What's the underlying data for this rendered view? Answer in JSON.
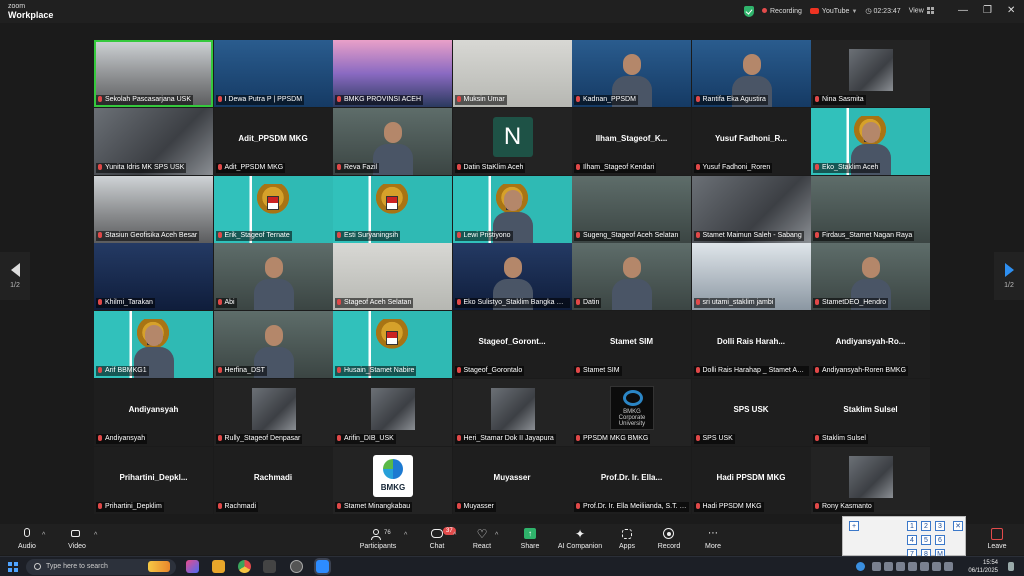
{
  "app": {
    "title_line1": "zoom",
    "title_line2": "Workplace"
  },
  "titlebar": {
    "recording": "Recording",
    "youtube": "YouTube",
    "timer": "02:23:47",
    "view": "View",
    "win_min": "—",
    "win_max": "❐",
    "win_close": "✕"
  },
  "gallery": {
    "page_left": "1/2",
    "page_right": "1/2",
    "tiles": [
      {
        "caption": "Sekolah Pascasarjana USK",
        "center": "",
        "kind": "room",
        "speaking": true
      },
      {
        "caption": "I Dewa Putra P | PPSDM",
        "center": "",
        "kind": "banner"
      },
      {
        "caption": "BMKG PROVINSI ACEH",
        "center": "",
        "kind": "mosque"
      },
      {
        "caption": "Muksin Umar",
        "center": "",
        "kind": "whiteboard"
      },
      {
        "caption": "Kadnan_PPSDM",
        "center": "",
        "kind": "banner-person"
      },
      {
        "caption": "Rantifa Eka Agustira",
        "center": "",
        "kind": "banner-person"
      },
      {
        "caption": "Nina Sasmita",
        "center": "",
        "kind": "small-photo"
      },
      {
        "caption": "Yunita Idris MK SPS USK",
        "center": "",
        "kind": "photo"
      },
      {
        "caption": "Adit_PPSDM MKG",
        "center": "Adit_PPSDM MKG",
        "kind": "blank"
      },
      {
        "caption": "Reva Fazil",
        "center": "",
        "kind": "person"
      },
      {
        "caption": "Datin StaKlim Aceh",
        "center": "",
        "kind": "letter",
        "letter": "N"
      },
      {
        "caption": "Ilham_Stageof Kendari",
        "center": "Ilham_Stageof_K...",
        "kind": "blank"
      },
      {
        "caption": "Yusuf Fadhoni_Roren",
        "center": "Yusuf Fadhoni_R...",
        "kind": "blank"
      },
      {
        "caption": "Eko_Staklim Aceh",
        "center": "",
        "kind": "teal-person"
      },
      {
        "caption": "Stasiun Geofisika Aceh Besar",
        "center": "",
        "kind": "room"
      },
      {
        "caption": "Erik_Stageof Ternate",
        "center": "",
        "kind": "teal"
      },
      {
        "caption": "Esti Suryaningsih",
        "center": "",
        "kind": "teal"
      },
      {
        "caption": "Lewi Pristiyono",
        "center": "",
        "kind": "teal-person"
      },
      {
        "caption": "Sugeng_Stageof Aceh Selatan",
        "center": "",
        "kind": "office"
      },
      {
        "caption": "Stamet Maimun Saleh - Sabang",
        "center": "",
        "kind": "photo"
      },
      {
        "caption": "Firdaus_Stamet Nagan Raya",
        "center": "",
        "kind": "office"
      },
      {
        "caption": "Khilmi_Tarakan",
        "center": "",
        "kind": "screen"
      },
      {
        "caption": "Abi",
        "center": "",
        "kind": "person"
      },
      {
        "caption": "Stageof Aceh Selatan",
        "center": "",
        "kind": "whiteboard"
      },
      {
        "caption": "Eko Sulistyo_Staklim Bangka Belit...",
        "center": "",
        "kind": "screen-person"
      },
      {
        "caption": "Datin",
        "center": "",
        "kind": "person"
      },
      {
        "caption": "sri utami_staklim jambi",
        "center": "",
        "kind": "city"
      },
      {
        "caption": "StametDEO_Hendro",
        "center": "",
        "kind": "person"
      },
      {
        "caption": "Arif BBMKG1",
        "center": "",
        "kind": "teal-person"
      },
      {
        "caption": "Herfina_DST",
        "center": "",
        "kind": "person"
      },
      {
        "caption": "Husain_Stamet Nabire",
        "center": "",
        "kind": "teal"
      },
      {
        "caption": "Stageof_Gorontalo",
        "center": "Stageof_Goront...",
        "kind": "blank"
      },
      {
        "caption": "Stamet SIM",
        "center": "Stamet SIM",
        "kind": "blank"
      },
      {
        "caption": "Dolli Rais Harahap _ Stamet Aek ...",
        "center": "Dolli Rais Harah...",
        "kind": "blank"
      },
      {
        "caption": "Andiyansyah-Roren BMKG",
        "center": "Andiyansyah-Ro...",
        "kind": "blank"
      },
      {
        "caption": "Andiyansyah",
        "center": "Andiyansyah",
        "kind": "blank"
      },
      {
        "caption": "Rully_Stageof Denpasar",
        "center": "",
        "kind": "small-photo"
      },
      {
        "caption": "Arifin_DIB_USK",
        "center": "",
        "kind": "small-photo"
      },
      {
        "caption": "Heri_Stamar Dok II Jayapura",
        "center": "",
        "kind": "small-photo"
      },
      {
        "caption": "PPSDM MKG BMKG",
        "center": "",
        "kind": "corp"
      },
      {
        "caption": "SPS USK",
        "center": "SPS USK",
        "kind": "blank"
      },
      {
        "caption": "Staklim Sulsel",
        "center": "Staklim Sulsel",
        "kind": "blank"
      },
      {
        "caption": "Prihartini_Depklim",
        "center": "Prihartini_Depkl...",
        "kind": "blank"
      },
      {
        "caption": "Rachmadi",
        "center": "Rachmadi",
        "kind": "blank"
      },
      {
        "caption": "Stamet Minangkabau",
        "center": "",
        "kind": "bmkg"
      },
      {
        "caption": "Muyasser",
        "center": "Muyasser",
        "kind": "blank"
      },
      {
        "caption": "Prof.Dr. Ir. Ella Meiliianda, S.T. M...",
        "center": "Prof.Dr. Ir. Ella...",
        "kind": "blank"
      },
      {
        "caption": "Hadi PPSDM MKG",
        "center": "Hadi PPSDM MKG",
        "kind": "blank"
      },
      {
        "caption": "Rony Kasmanto",
        "center": "",
        "kind": "small-photo"
      }
    ],
    "corp_text": "BMKG Corporate University",
    "bmkg_text": "BMKG"
  },
  "toolbar": {
    "audio": "Audio",
    "video": "Video",
    "participants": "Participants",
    "participants_count": "76",
    "chat": "Chat",
    "chat_badge": "37",
    "react": "React",
    "share": "Share",
    "ai": "AI Companion",
    "apps": "Apps",
    "record": "Record",
    "more": "More",
    "leave": "Leave"
  },
  "keypad": {
    "keys": [
      "+",
      "1",
      "2",
      "3",
      "✕",
      "4",
      "5",
      "6",
      "7",
      "8",
      "M"
    ]
  },
  "taskbar": {
    "search_placeholder": "Type here to search",
    "time": "15:54",
    "date": "06/11/2025"
  },
  "colors": {
    "accent": "#2e8ff0",
    "speaking": "#35c93d",
    "muted": "#e04848",
    "share": "#2fb36b"
  }
}
